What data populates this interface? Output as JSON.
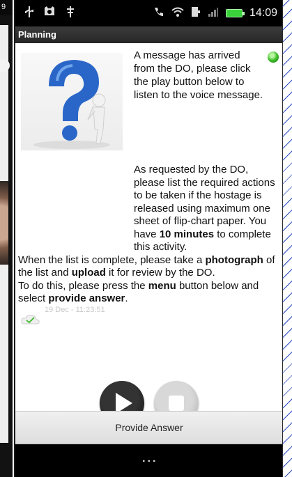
{
  "left_status_digit": "9",
  "status_bar": {
    "time": "14:09",
    "icons_left": [
      "usb-icon",
      "cat-icon",
      "gesture-icon"
    ],
    "icons_right": [
      "call-icon",
      "wifi-icon",
      "data-icon",
      "signal-icon",
      "battery-icon"
    ]
  },
  "title_bar": {
    "title": "Planning"
  },
  "message": {
    "intro_line": "A message has arrived from the DO, please click the play button below to listen to the voice message.",
    "request_part1": "As requested by the DO, please list the required actions to be taken if the hostage is released using maximum one sheet of flip-chart paper. You have ",
    "request_bold": "10 minutes",
    "request_part2": " to complete this activity.",
    "photo_part1": "When the list is complete, please take a ",
    "photo_bold1": "photograph",
    "photo_part2": " of the list and ",
    "photo_bold2": "upload",
    "photo_part3": " it for review by the DO.",
    "menu_part1": "To do this, please press the ",
    "menu_bold1": "menu",
    "menu_part2": " button below and select ",
    "menu_bold2": "provide answer",
    "menu_part3": "."
  },
  "timestamp": "19 Dec - 11:23:51",
  "provide_answer": {
    "label": "Provide Answer"
  },
  "menu_glyph": "⋮",
  "colors": {
    "status_bg": "#000000",
    "title_bg": "#2c2c2c",
    "battery": "#3ad23a",
    "green_dot": "#3fbe2c",
    "timestamp": "#c9c9c9"
  }
}
